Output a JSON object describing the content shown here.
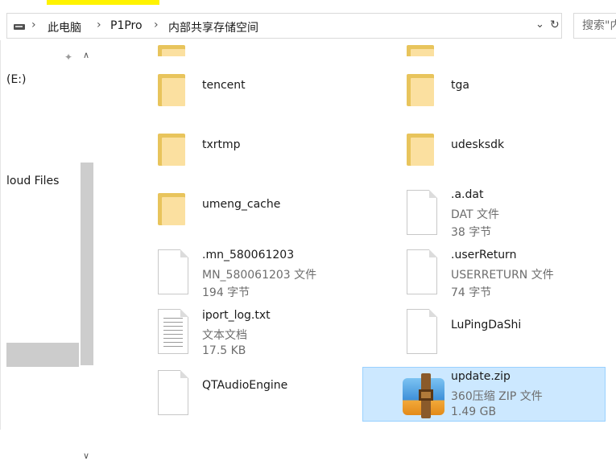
{
  "address": {
    "crumbs": [
      "此电脑",
      "P1Pro",
      "内部共享存储空间"
    ]
  },
  "search": {
    "placeholder": "搜索\"内"
  },
  "nav": {
    "drive_label": "(E:)",
    "cloud_label": "loud Files"
  },
  "items": [
    {
      "name": "tencent",
      "type": "folder"
    },
    {
      "name": "tga",
      "type": "folder"
    },
    {
      "name": "txrtmp",
      "type": "folder"
    },
    {
      "name": "udesksdk",
      "type": "folder"
    },
    {
      "name": "umeng_cache",
      "type": "folder"
    },
    {
      "name": ".a.dat",
      "kind": "DAT 文件",
      "size": "38 字节"
    },
    {
      "name": ".mn_580061203",
      "kind": "MN_580061203 文件",
      "size": "194 字节"
    },
    {
      "name": ".userReturn",
      "kind": "USERRETURN 文件",
      "size": "74 字节"
    },
    {
      "name": "iport_log.txt",
      "kind": "文本文档",
      "size": "17.5 KB"
    },
    {
      "name": "LuPingDaShi"
    },
    {
      "name": "QTAudioEngine"
    },
    {
      "name": "update.zip",
      "kind": "360压缩 ZIP 文件",
      "size": "1.49 GB"
    }
  ]
}
